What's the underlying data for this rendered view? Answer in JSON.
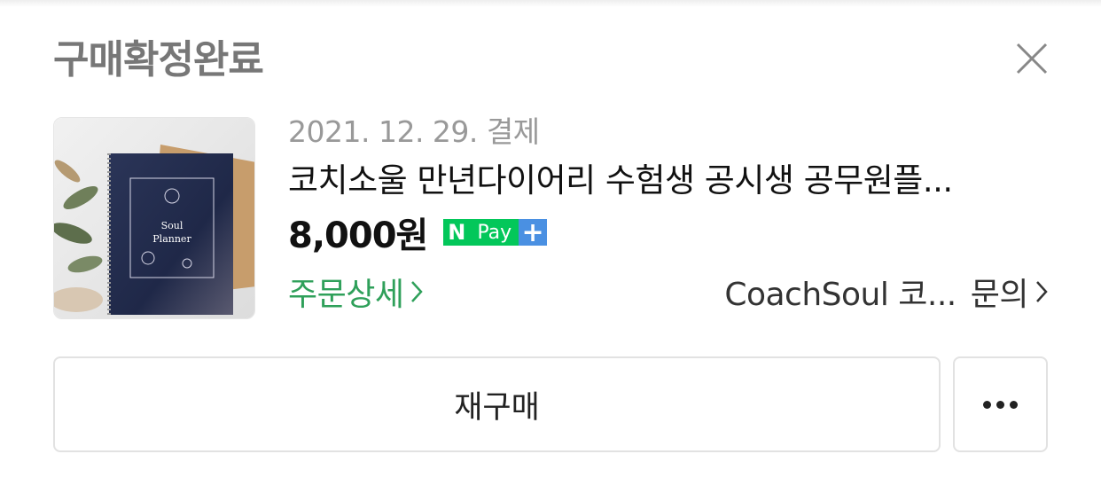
{
  "order": {
    "status": "구매확정완료",
    "date": "2021. 12. 29. 결제",
    "title": "코치소울 만년다이어리 수험생 공시생 공무원플...",
    "price": "8,000원",
    "badge": {
      "n": "N",
      "pay": "Pay",
      "plus": "+"
    },
    "detail_link": "주문상세",
    "seller": "CoachSoul 코...",
    "inquiry": "문의",
    "thumbnail": {
      "cover_line1": "Soul",
      "cover_line2": "Planner"
    }
  },
  "actions": {
    "rebuy": "재구매",
    "more_icon": "more-horizontal-icon"
  },
  "colors": {
    "status": "#777777",
    "accent_green": "#2fa05a",
    "npay_green": "#03c75a",
    "npay_blue": "#4a90e2"
  }
}
